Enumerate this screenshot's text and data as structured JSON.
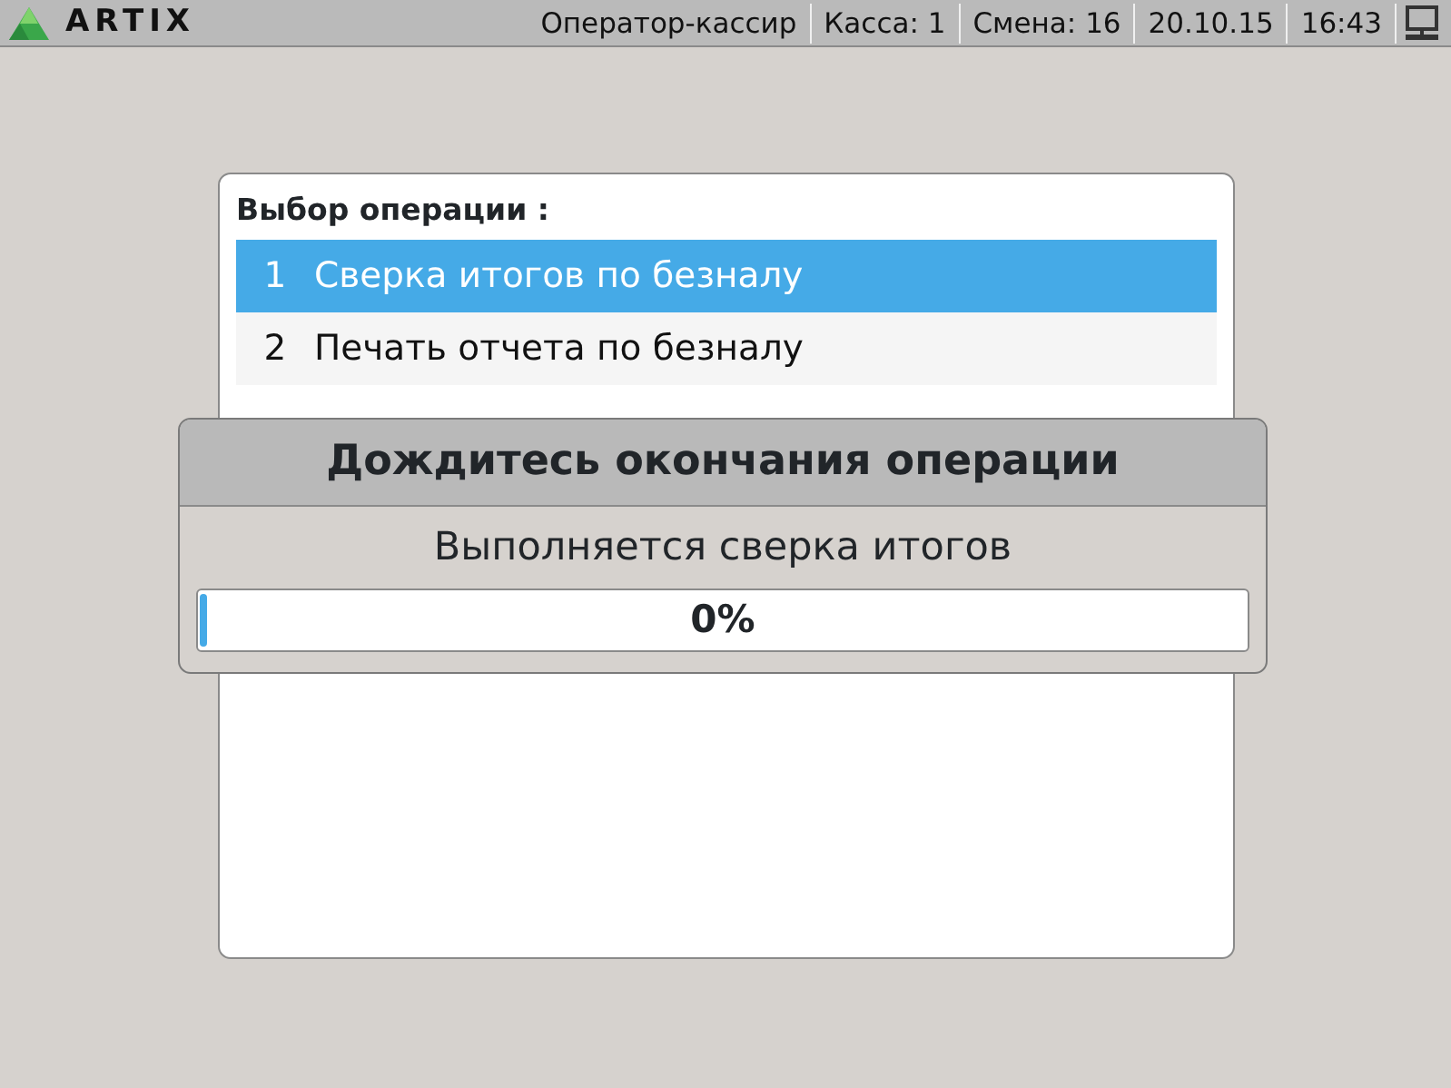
{
  "top_bar": {
    "logo": "ARTIX",
    "fields": [
      "Оператор-кассир",
      "Касса: 1",
      "Смена: 16",
      "20.10.15",
      "16:43"
    ]
  },
  "menu": {
    "title": "Выбор операции :",
    "items": [
      {
        "number": "1",
        "label": "Сверка итогов по безналу",
        "selected": true
      },
      {
        "number": "2",
        "label": "Печать отчета по безналу",
        "selected": false
      }
    ]
  },
  "dialog": {
    "title": "Дождитесь окончания операции",
    "message": "Выполняется сверка итогов",
    "progress": {
      "level": 0,
      "reading": "0%"
    }
  }
}
